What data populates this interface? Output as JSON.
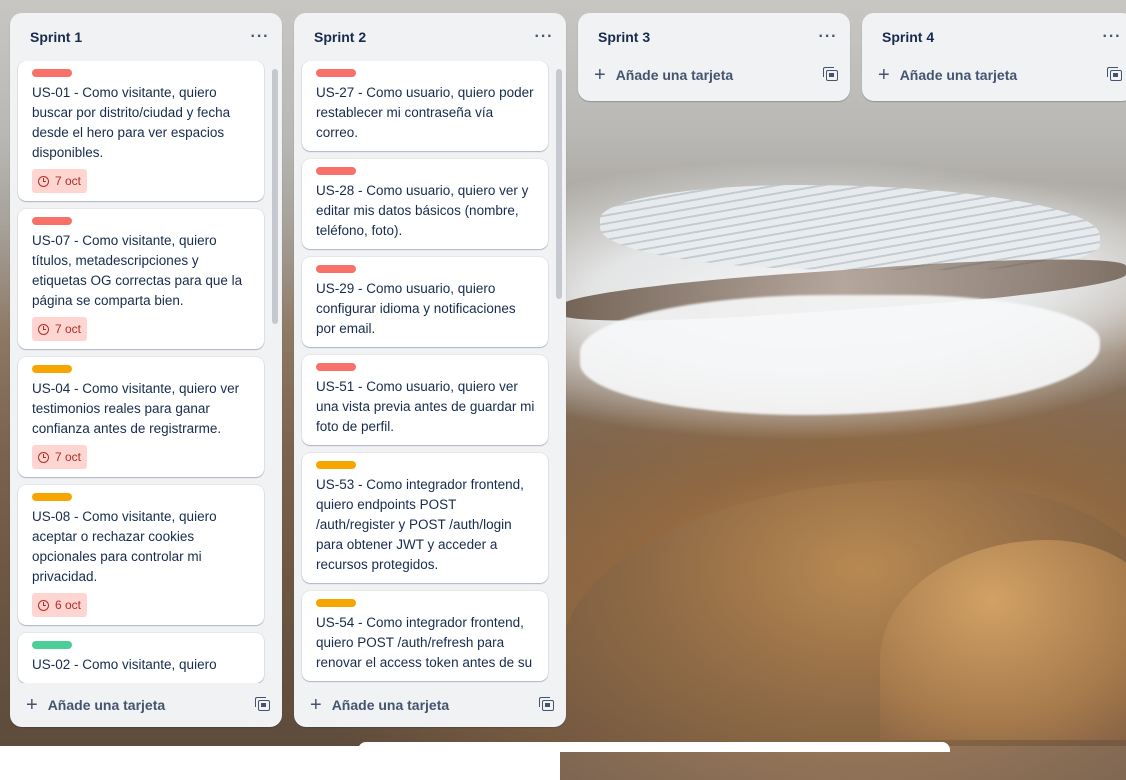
{
  "colors": {
    "red": "#f87168",
    "orange": "#f5a600",
    "green": "#4bce97"
  },
  "lists": [
    {
      "title": "Sprint 1",
      "menu_icon": "more-dots-icon",
      "add_label": "Añade una tarjeta",
      "cards": [
        {
          "label": "red",
          "text": "US-01 - Como visitante, quiero buscar por distrito/ciudad y fecha desde el hero para ver espacios disponibles.",
          "due": "7 oct"
        },
        {
          "label": "red",
          "text": "US-07 - Como visitante, quiero títulos, metadescripciones y etiquetas OG correctas para que la página se comparta bien.",
          "due": "7 oct"
        },
        {
          "label": "orange",
          "text": "US-04 - Como visitante, quiero ver testimonios reales para ganar confianza antes de registrarme.",
          "due": "7 oct"
        },
        {
          "label": "orange",
          "text": "US-08 - Como visitante, quiero aceptar o rechazar cookies opcionales para controlar mi privacidad.",
          "due": "6 oct"
        },
        {
          "label": "green",
          "text": "US-02 - Como visitante, quiero",
          "due": ""
        }
      ]
    },
    {
      "title": "Sprint 2",
      "menu_icon": "more-dots-icon",
      "add_label": "Añade una tarjeta",
      "cards": [
        {
          "label": "red",
          "text": "US-27 - Como usuario, quiero poder restablecer mi contraseña vía correo."
        },
        {
          "label": "red",
          "text": "US-28 - Como usuario, quiero ver y editar mis datos básicos (nombre, teléfono, foto)."
        },
        {
          "label": "red",
          "text": "US-29 - Como usuario, quiero configurar idioma y notificaciones por email."
        },
        {
          "label": "red",
          "text": "US-51 - Como usuario, quiero ver una vista previa antes de guardar mi foto de perfil."
        },
        {
          "label": "orange",
          "text": "US-53 - Como integrador frontend, quiero endpoints POST /auth/register y POST /auth/login para obtener JWT y acceder a recursos protegidos."
        },
        {
          "label": "orange",
          "text": "US-54 - Como integrador frontend, quiero POST /auth/refresh para renovar el access token antes de su"
        }
      ]
    },
    {
      "title": "Sprint 3",
      "menu_icon": "more-dots-icon",
      "add_label": "Añade una tarjeta"
    },
    {
      "title": "Sprint 4",
      "menu_icon": "more-dots-icon",
      "add_label": "Añade una tarjeta"
    }
  ]
}
